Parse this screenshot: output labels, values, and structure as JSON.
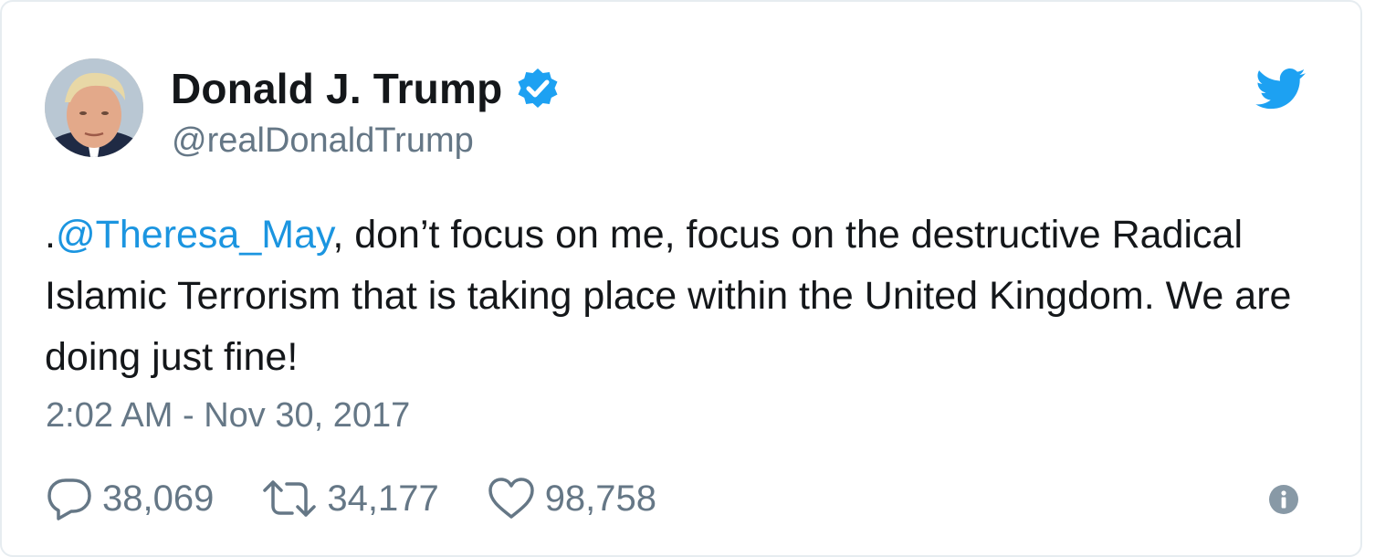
{
  "author": {
    "display_name": "Donald J. Trump",
    "handle": "@realDonaldTrump",
    "verified": true,
    "avatar_icon": "avatar-photo"
  },
  "tweet": {
    "prefix": ".",
    "mention": "@Theresa_May",
    "body": ", don’t focus on me, focus on the destructive Radical Islamic Terrorism that is taking place within the United Kingdom. We are doing just fine!",
    "timestamp": "2:02 AM - Nov 30, 2017"
  },
  "stats": {
    "replies": "38,069",
    "retweets": "34,177",
    "likes": "98,758"
  },
  "icons": {
    "brand": "twitter-bird-icon",
    "reply": "reply-icon",
    "retweet": "retweet-icon",
    "like": "heart-icon",
    "info": "info-icon",
    "verified": "verified-badge-icon"
  },
  "colors": {
    "brand_blue": "#1da1f2",
    "link_blue": "#1b95e0",
    "text": "#14171a",
    "secondary_text": "#657786"
  }
}
